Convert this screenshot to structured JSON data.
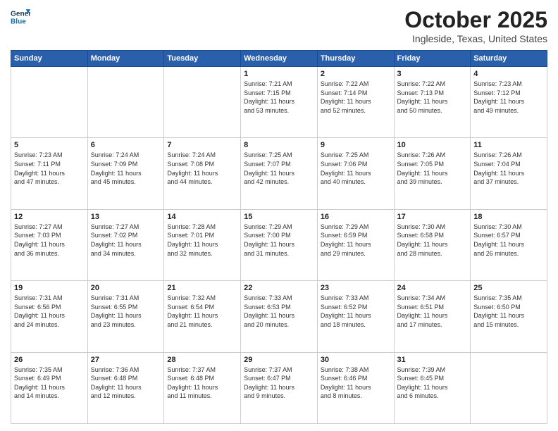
{
  "header": {
    "logo_line1": "General",
    "logo_line2": "Blue",
    "month": "October 2025",
    "location": "Ingleside, Texas, United States"
  },
  "days_of_week": [
    "Sunday",
    "Monday",
    "Tuesday",
    "Wednesday",
    "Thursday",
    "Friday",
    "Saturday"
  ],
  "weeks": [
    [
      {
        "day": "",
        "info": ""
      },
      {
        "day": "",
        "info": ""
      },
      {
        "day": "",
        "info": ""
      },
      {
        "day": "1",
        "info": "Sunrise: 7:21 AM\nSunset: 7:15 PM\nDaylight: 11 hours\nand 53 minutes."
      },
      {
        "day": "2",
        "info": "Sunrise: 7:22 AM\nSunset: 7:14 PM\nDaylight: 11 hours\nand 52 minutes."
      },
      {
        "day": "3",
        "info": "Sunrise: 7:22 AM\nSunset: 7:13 PM\nDaylight: 11 hours\nand 50 minutes."
      },
      {
        "day": "4",
        "info": "Sunrise: 7:23 AM\nSunset: 7:12 PM\nDaylight: 11 hours\nand 49 minutes."
      }
    ],
    [
      {
        "day": "5",
        "info": "Sunrise: 7:23 AM\nSunset: 7:11 PM\nDaylight: 11 hours\nand 47 minutes."
      },
      {
        "day": "6",
        "info": "Sunrise: 7:24 AM\nSunset: 7:09 PM\nDaylight: 11 hours\nand 45 minutes."
      },
      {
        "day": "7",
        "info": "Sunrise: 7:24 AM\nSunset: 7:08 PM\nDaylight: 11 hours\nand 44 minutes."
      },
      {
        "day": "8",
        "info": "Sunrise: 7:25 AM\nSunset: 7:07 PM\nDaylight: 11 hours\nand 42 minutes."
      },
      {
        "day": "9",
        "info": "Sunrise: 7:25 AM\nSunset: 7:06 PM\nDaylight: 11 hours\nand 40 minutes."
      },
      {
        "day": "10",
        "info": "Sunrise: 7:26 AM\nSunset: 7:05 PM\nDaylight: 11 hours\nand 39 minutes."
      },
      {
        "day": "11",
        "info": "Sunrise: 7:26 AM\nSunset: 7:04 PM\nDaylight: 11 hours\nand 37 minutes."
      }
    ],
    [
      {
        "day": "12",
        "info": "Sunrise: 7:27 AM\nSunset: 7:03 PM\nDaylight: 11 hours\nand 36 minutes."
      },
      {
        "day": "13",
        "info": "Sunrise: 7:27 AM\nSunset: 7:02 PM\nDaylight: 11 hours\nand 34 minutes."
      },
      {
        "day": "14",
        "info": "Sunrise: 7:28 AM\nSunset: 7:01 PM\nDaylight: 11 hours\nand 32 minutes."
      },
      {
        "day": "15",
        "info": "Sunrise: 7:29 AM\nSunset: 7:00 PM\nDaylight: 11 hours\nand 31 minutes."
      },
      {
        "day": "16",
        "info": "Sunrise: 7:29 AM\nSunset: 6:59 PM\nDaylight: 11 hours\nand 29 minutes."
      },
      {
        "day": "17",
        "info": "Sunrise: 7:30 AM\nSunset: 6:58 PM\nDaylight: 11 hours\nand 28 minutes."
      },
      {
        "day": "18",
        "info": "Sunrise: 7:30 AM\nSunset: 6:57 PM\nDaylight: 11 hours\nand 26 minutes."
      }
    ],
    [
      {
        "day": "19",
        "info": "Sunrise: 7:31 AM\nSunset: 6:56 PM\nDaylight: 11 hours\nand 24 minutes."
      },
      {
        "day": "20",
        "info": "Sunrise: 7:31 AM\nSunset: 6:55 PM\nDaylight: 11 hours\nand 23 minutes."
      },
      {
        "day": "21",
        "info": "Sunrise: 7:32 AM\nSunset: 6:54 PM\nDaylight: 11 hours\nand 21 minutes."
      },
      {
        "day": "22",
        "info": "Sunrise: 7:33 AM\nSunset: 6:53 PM\nDaylight: 11 hours\nand 20 minutes."
      },
      {
        "day": "23",
        "info": "Sunrise: 7:33 AM\nSunset: 6:52 PM\nDaylight: 11 hours\nand 18 minutes."
      },
      {
        "day": "24",
        "info": "Sunrise: 7:34 AM\nSunset: 6:51 PM\nDaylight: 11 hours\nand 17 minutes."
      },
      {
        "day": "25",
        "info": "Sunrise: 7:35 AM\nSunset: 6:50 PM\nDaylight: 11 hours\nand 15 minutes."
      }
    ],
    [
      {
        "day": "26",
        "info": "Sunrise: 7:35 AM\nSunset: 6:49 PM\nDaylight: 11 hours\nand 14 minutes."
      },
      {
        "day": "27",
        "info": "Sunrise: 7:36 AM\nSunset: 6:48 PM\nDaylight: 11 hours\nand 12 minutes."
      },
      {
        "day": "28",
        "info": "Sunrise: 7:37 AM\nSunset: 6:48 PM\nDaylight: 11 hours\nand 11 minutes."
      },
      {
        "day": "29",
        "info": "Sunrise: 7:37 AM\nSunset: 6:47 PM\nDaylight: 11 hours\nand 9 minutes."
      },
      {
        "day": "30",
        "info": "Sunrise: 7:38 AM\nSunset: 6:46 PM\nDaylight: 11 hours\nand 8 minutes."
      },
      {
        "day": "31",
        "info": "Sunrise: 7:39 AM\nSunset: 6:45 PM\nDaylight: 11 hours\nand 6 minutes."
      },
      {
        "day": "",
        "info": ""
      }
    ]
  ]
}
